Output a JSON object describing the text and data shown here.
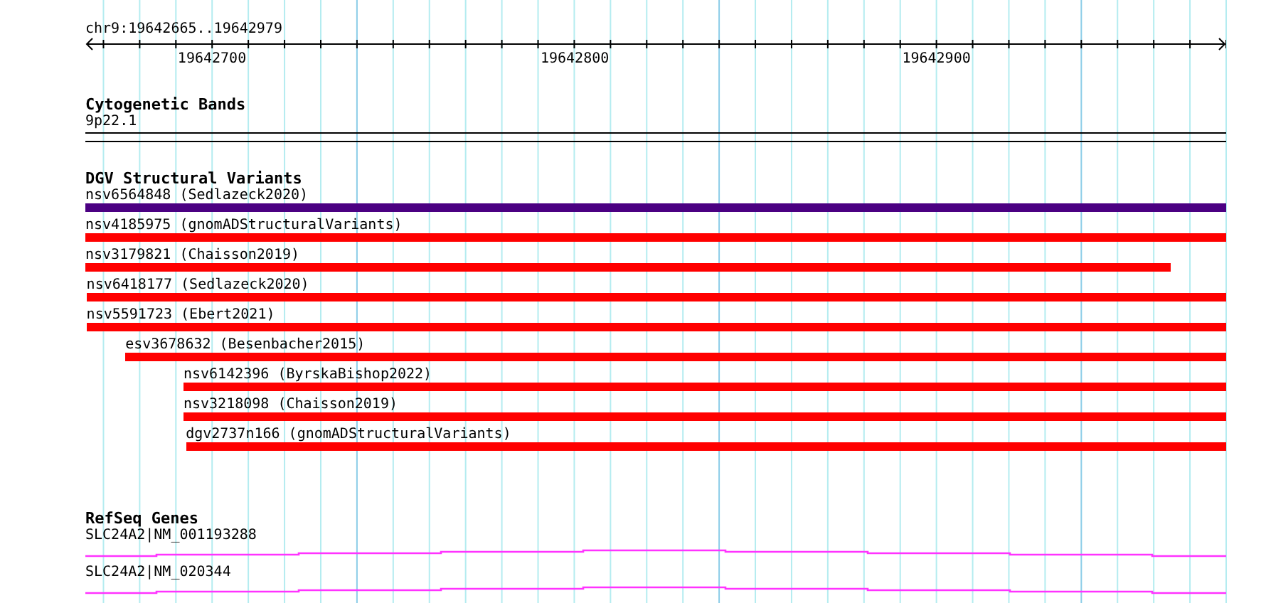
{
  "ruler": {
    "location": "chr9:19642665..19642979",
    "ticks": [
      {
        "label": "19642700"
      },
      {
        "label": "19642800"
      },
      {
        "label": "19642900"
      }
    ]
  },
  "tracks": [
    {
      "kind": "bands",
      "title": "Cytogenetic Bands",
      "features": [
        {
          "label": "9p22.1"
        }
      ]
    },
    {
      "kind": "variants",
      "title": "DGV Structural Variants",
      "features": [
        {
          "label": "nsv6564848 (Sedlazeck2020)",
          "color": "#4b0082"
        },
        {
          "label": "nsv4185975 (gnomADStructuralVariants)",
          "color": "#ff0000"
        },
        {
          "label": "nsv3179821 (Chaisson2019)",
          "color": "#ff0000"
        },
        {
          "label": "nsv6418177 (Sedlazeck2020)",
          "color": "#ff0000"
        },
        {
          "label": "nsv5591723 (Ebert2021)",
          "color": "#ff0000"
        },
        {
          "label": "esv3678632 (Besenbacher2015)",
          "color": "#ff0000"
        },
        {
          "label": "nsv6142396 (ByrskaBishop2022)",
          "color": "#ff0000"
        },
        {
          "label": "nsv3218098 (Chaisson2019)",
          "color": "#ff0000"
        },
        {
          "label": "dgv2737n166 (gnomADStructuralVariants)",
          "color": "#ff0000"
        }
      ]
    },
    {
      "kind": "genes",
      "title": "RefSeq Genes",
      "features": [
        {
          "label": "SLC24A2|NM_001193288"
        },
        {
          "label": "SLC24A2|NM_020344"
        }
      ]
    }
  ]
}
